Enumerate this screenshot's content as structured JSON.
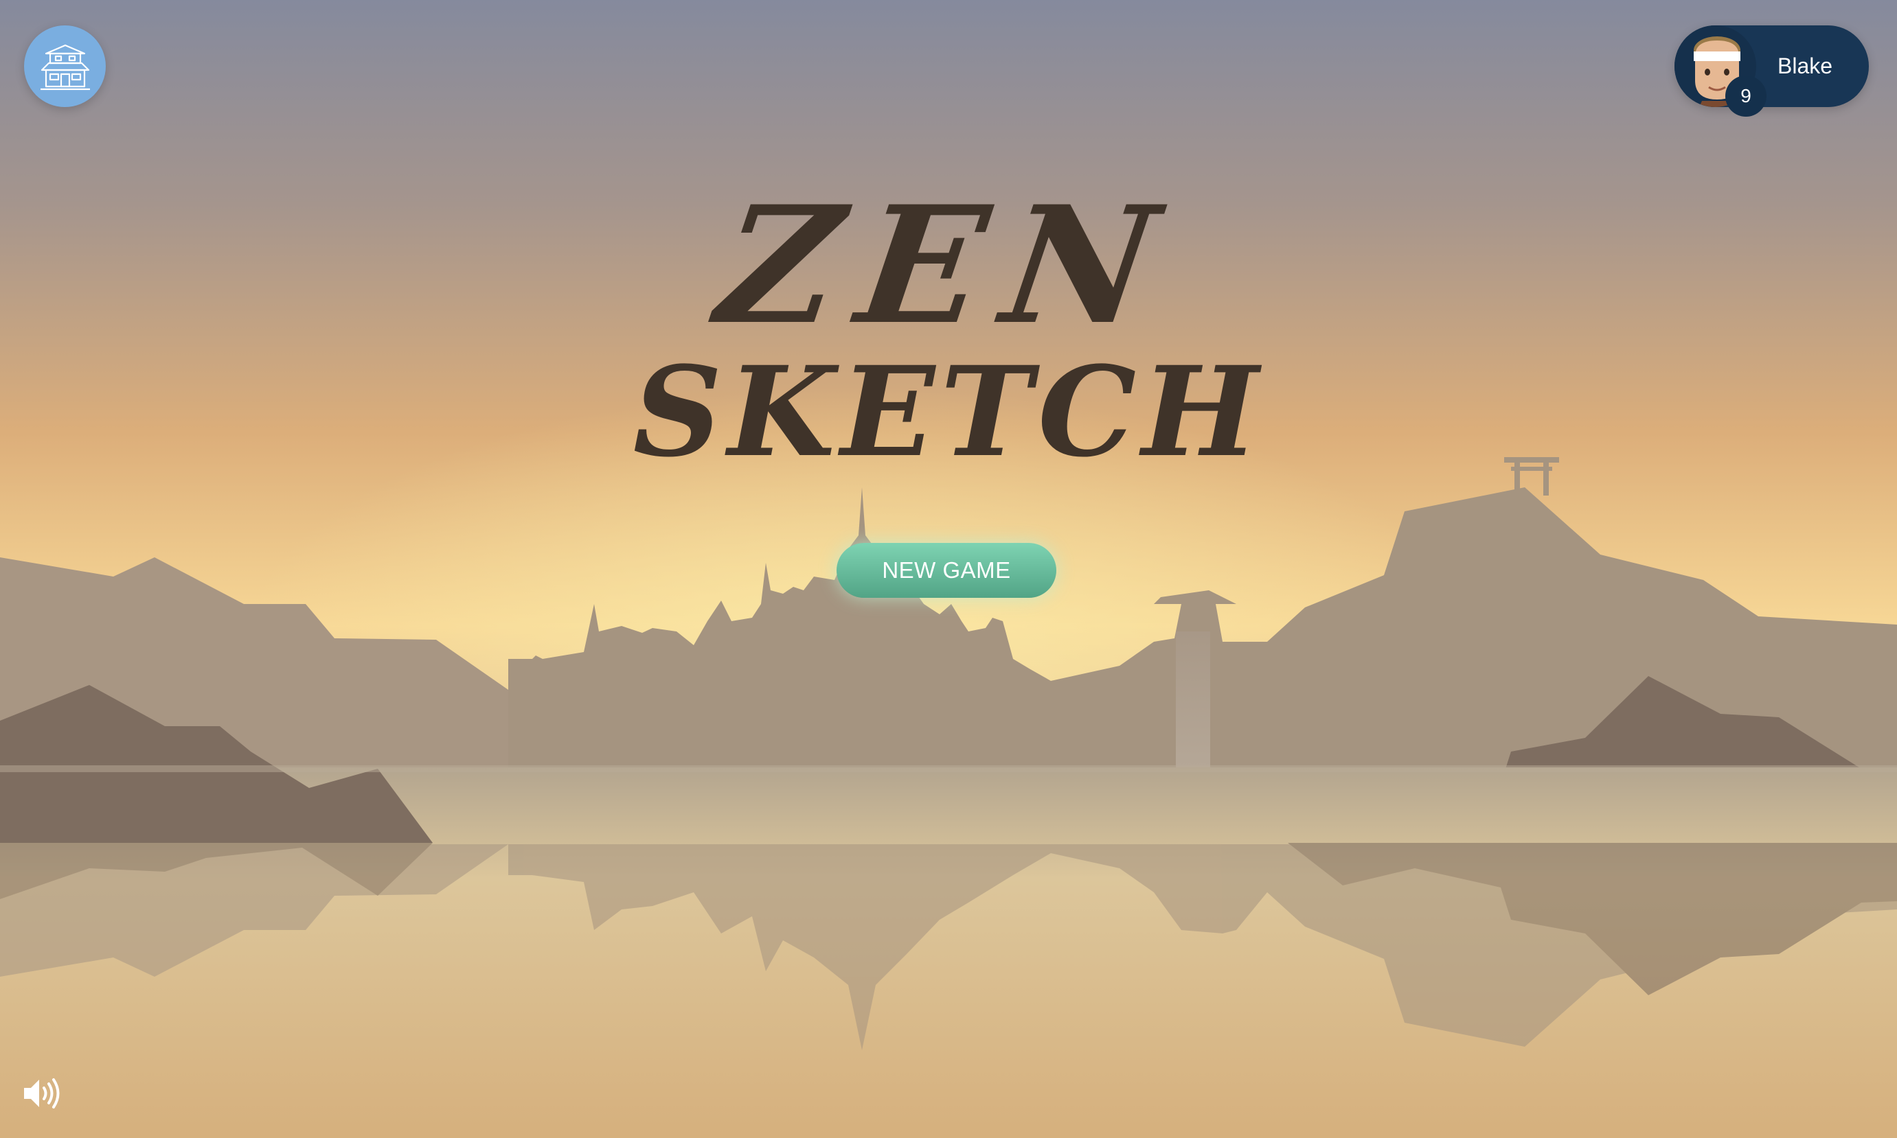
{
  "game": {
    "title_line1": "ZEN",
    "title_line2": "SKETCH"
  },
  "header": {
    "home_icon": "pagoda-house-icon",
    "profile": {
      "name": "Blake",
      "level": "9",
      "avatar_icon": "player-headband-avatar-icon"
    }
  },
  "main": {
    "new_game_label": "NEW GAME"
  },
  "footer": {
    "sound_icon": "speaker-volume-icon"
  },
  "colors": {
    "sky_top": "#878a9c",
    "sky_glow": "#f2c87e",
    "title": "#3f3329",
    "button": "#64bc9b",
    "profile_bg": "#183655",
    "home_button": "#7aaee0",
    "silhouette": "#a59480"
  }
}
